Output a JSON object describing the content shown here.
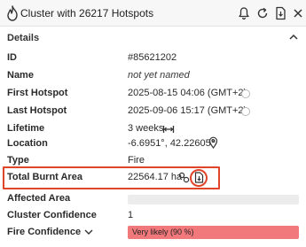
{
  "header": {
    "title": "Cluster with 26217 Hotspots",
    "icons": [
      "flame-icon",
      "bell-icon",
      "refresh-icon",
      "document-icon",
      "close-icon"
    ]
  },
  "details": {
    "section_label": "Details",
    "rows": [
      {
        "key": "ID",
        "value": "#85621202"
      },
      {
        "key": "Name",
        "value": "not yet named"
      },
      {
        "key": "First Hotspot",
        "value": "2025-08-15 04:06 (GMT+2)"
      },
      {
        "key": "Last Hotspot",
        "value": "2025-09-06 15:17 (GMT+2)"
      },
      {
        "key": "Lifetime",
        "value": "3 weeks"
      },
      {
        "key": "Location",
        "value": "-6.6951°, 42.22605°"
      },
      {
        "key": "Type",
        "value": "Fire"
      },
      {
        "key": "Total Burnt Area",
        "value": "22564.17 ha"
      },
      {
        "key": "Affected Area",
        "value": ""
      },
      {
        "key": "Cluster Confidence",
        "value": "1"
      },
      {
        "key": "Fire Confidence",
        "value": "Very likely (90 %)"
      }
    ]
  },
  "colors": {
    "highlight": "#e0452a",
    "confidence_bar": "#f1797b",
    "empty_bar": "#ececec"
  }
}
